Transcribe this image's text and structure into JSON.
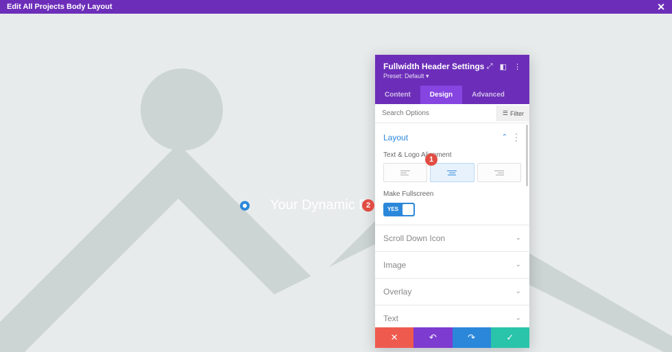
{
  "top_bar": {
    "title": "Edit All Projects Body Layout"
  },
  "canvas": {
    "post_title": "Your Dynamic Post Title W"
  },
  "badges": {
    "one": "1",
    "two": "2"
  },
  "panel": {
    "title": "Fullwidth Header Settings",
    "preset": "Preset: Default ",
    "tabs": {
      "content": "Content",
      "design": "Design",
      "advanced": "Advanced"
    },
    "search_placeholder": "Search Options",
    "filter_label": "Filter",
    "sections": {
      "layout": {
        "title": "Layout",
        "text_align_label": "Text & Logo Alignment",
        "fullscreen_label": "Make Fullscreen",
        "toggle_yes": "YES"
      },
      "scroll": "Scroll Down Icon",
      "image": "Image",
      "overlay": "Overlay",
      "text": "Text"
    }
  }
}
